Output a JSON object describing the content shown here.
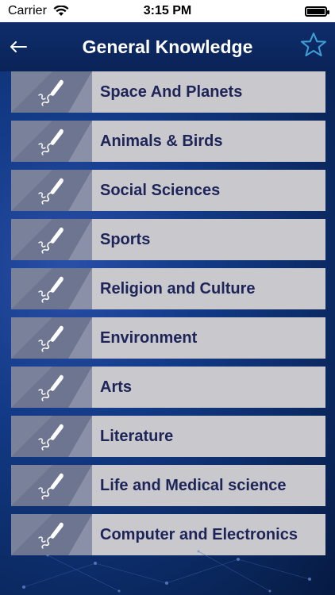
{
  "status": {
    "carrier": "Carrier",
    "time": "3:15 PM"
  },
  "header": {
    "title": "General Knowledge"
  },
  "categories": [
    {
      "label": "Space And Planets"
    },
    {
      "label": "Animals & Birds"
    },
    {
      "label": "Social Sciences"
    },
    {
      "label": "Sports"
    },
    {
      "label": "Religion and Culture"
    },
    {
      "label": "Environment"
    },
    {
      "label": "Arts"
    },
    {
      "label": "Literature"
    },
    {
      "label": "Life and Medical science"
    },
    {
      "label": "Computer and Electronics"
    }
  ],
  "icons": {
    "back": "back-arrow-icon",
    "favorite": "star-icon",
    "category": "paintbrush-icon"
  },
  "colors": {
    "accent": "#3fa0d8",
    "label": "#1e2457",
    "tile": "#c8c8cd"
  }
}
